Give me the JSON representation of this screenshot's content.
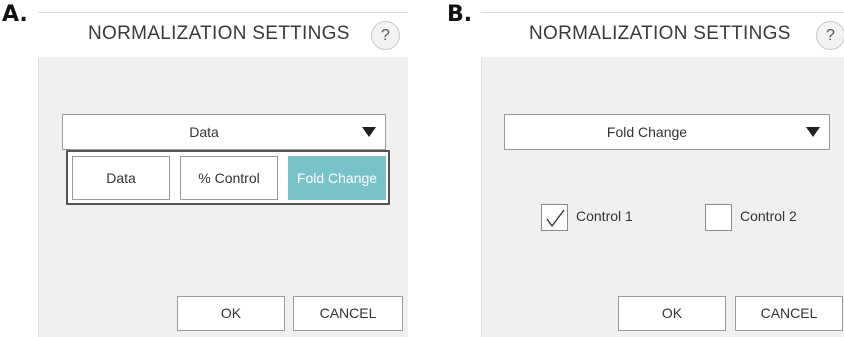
{
  "labels": {
    "a": "A.",
    "b": "B."
  },
  "dialog_a": {
    "title": "NORMALIZATION SETTINGS",
    "help_label": "?",
    "dropdown_value": "Data",
    "options": [
      "Data",
      "% Control",
      "Fold Change"
    ],
    "selected_option": "Fold Change",
    "ok_label": "OK",
    "cancel_label": "CANCEL"
  },
  "dialog_b": {
    "title": "NORMALIZATION SETTINGS",
    "help_label": "?",
    "dropdown_value": "Fold Change",
    "controls": [
      {
        "label": "Control 1",
        "checked": true
      },
      {
        "label": "Control 2",
        "checked": false
      }
    ],
    "ok_label": "OK",
    "cancel_label": "CANCEL"
  },
  "colors": {
    "selected_option_bg": "#76c4c8",
    "body_bg": "#f0f0f0"
  },
  "icons": {
    "help": "question-mark-icon",
    "caret": "caret-down-icon",
    "check": "checkmark-icon"
  }
}
